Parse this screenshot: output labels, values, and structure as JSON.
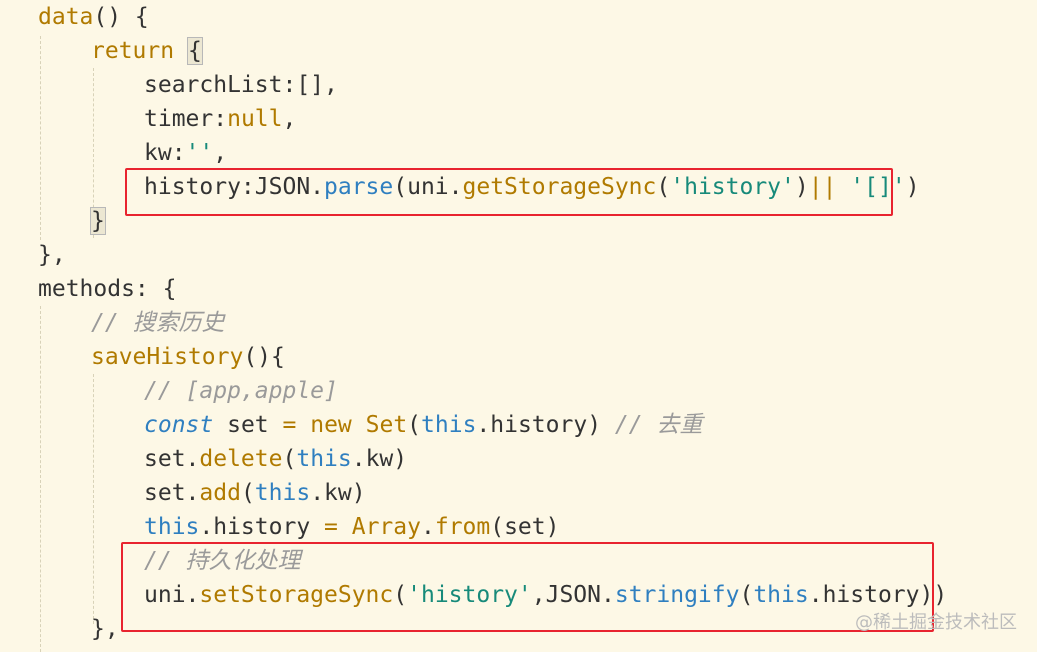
{
  "editor": {
    "lines": [
      {
        "tokens": [
          {
            "t": "data",
            "c": "fn"
          },
          {
            "t": "() {",
            "c": "plain"
          }
        ]
      },
      {
        "tokens": [
          {
            "t": "return",
            "c": "kw"
          },
          {
            "t": " ",
            "c": "plain"
          },
          {
            "t": "{",
            "c": "bracket"
          }
        ]
      },
      {
        "tokens": [
          {
            "t": "searchList:[],",
            "c": "plain"
          }
        ]
      },
      {
        "tokens": [
          {
            "t": "timer:",
            "c": "plain"
          },
          {
            "t": "null",
            "c": "null"
          },
          {
            "t": ",",
            "c": "plain"
          }
        ]
      },
      {
        "tokens": [
          {
            "t": "kw:",
            "c": "plain"
          },
          {
            "t": "''",
            "c": "str"
          },
          {
            "t": ",",
            "c": "plain"
          }
        ]
      },
      {
        "tokens": [
          {
            "t": "history:JSON.",
            "c": "plain"
          },
          {
            "t": "parse",
            "c": "blue"
          },
          {
            "t": "(uni.",
            "c": "plain"
          },
          {
            "t": "getStorageSync",
            "c": "method"
          },
          {
            "t": "(",
            "c": "plain"
          },
          {
            "t": "'history'",
            "c": "str"
          },
          {
            "t": ")",
            "c": "plain"
          },
          {
            "t": "||",
            "c": "op"
          },
          {
            "t": " ",
            "c": "plain"
          },
          {
            "t": "'[]'",
            "c": "str"
          },
          {
            "t": ")",
            "c": "plain"
          }
        ]
      },
      {
        "tokens": [
          {
            "t": "}",
            "c": "bracket"
          }
        ]
      },
      {
        "tokens": [
          {
            "t": "},",
            "c": "plain"
          }
        ]
      },
      {
        "tokens": [
          {
            "t": "methods: {",
            "c": "plain"
          }
        ]
      },
      {
        "tokens": [
          {
            "t": "// 搜索历史",
            "c": "comment"
          }
        ]
      },
      {
        "tokens": [
          {
            "t": "saveHistory",
            "c": "fn"
          },
          {
            "t": "(){",
            "c": "plain"
          }
        ]
      },
      {
        "tokens": [
          {
            "t": "// [app,apple]",
            "c": "comment"
          }
        ]
      },
      {
        "tokens": [
          {
            "t": "const",
            "c": "const"
          },
          {
            "t": " set ",
            "c": "plain"
          },
          {
            "t": "=",
            "c": "op"
          },
          {
            "t": " ",
            "c": "plain"
          },
          {
            "t": "new",
            "c": "kw"
          },
          {
            "t": " ",
            "c": "plain"
          },
          {
            "t": "Set",
            "c": "fn"
          },
          {
            "t": "(",
            "c": "plain"
          },
          {
            "t": "this",
            "c": "this"
          },
          {
            "t": ".history) ",
            "c": "plain"
          },
          {
            "t": "// 去重",
            "c": "comment"
          }
        ]
      },
      {
        "tokens": [
          {
            "t": "set.",
            "c": "plain"
          },
          {
            "t": "delete",
            "c": "method"
          },
          {
            "t": "(",
            "c": "plain"
          },
          {
            "t": "this",
            "c": "this"
          },
          {
            "t": ".kw)",
            "c": "plain"
          }
        ]
      },
      {
        "tokens": [
          {
            "t": "set.",
            "c": "plain"
          },
          {
            "t": "add",
            "c": "method"
          },
          {
            "t": "(",
            "c": "plain"
          },
          {
            "t": "this",
            "c": "this"
          },
          {
            "t": ".kw)",
            "c": "plain"
          }
        ]
      },
      {
        "tokens": [
          {
            "t": "this",
            "c": "this"
          },
          {
            "t": ".history ",
            "c": "plain"
          },
          {
            "t": "=",
            "c": "op"
          },
          {
            "t": " ",
            "c": "plain"
          },
          {
            "t": "Array",
            "c": "fn"
          },
          {
            "t": ".",
            "c": "plain"
          },
          {
            "t": "from",
            "c": "method"
          },
          {
            "t": "(set)",
            "c": "plain"
          }
        ]
      },
      {
        "tokens": [
          {
            "t": "// 持久化处理",
            "c": "comment"
          }
        ]
      },
      {
        "tokens": [
          {
            "t": "uni.",
            "c": "plain"
          },
          {
            "t": "setStorageSync",
            "c": "method"
          },
          {
            "t": "(",
            "c": "plain"
          },
          {
            "t": "'history'",
            "c": "str"
          },
          {
            "t": ",JSON.",
            "c": "plain"
          },
          {
            "t": "stringify",
            "c": "blue"
          },
          {
            "t": "(",
            "c": "plain"
          },
          {
            "t": "this",
            "c": "this"
          },
          {
            "t": ".history))",
            "c": "plain"
          }
        ]
      },
      {
        "tokens": [
          {
            "t": "},",
            "c": "plain"
          }
        ]
      }
    ]
  },
  "watermark": "@稀土掘金技术社区",
  "colors": {
    "background": "#fdf8e6",
    "highlight_border": "#e8242f",
    "string": "#178a7a",
    "keyword": "#b07a00",
    "this": "#2f7fc0",
    "comment": "#9a9a9a"
  }
}
